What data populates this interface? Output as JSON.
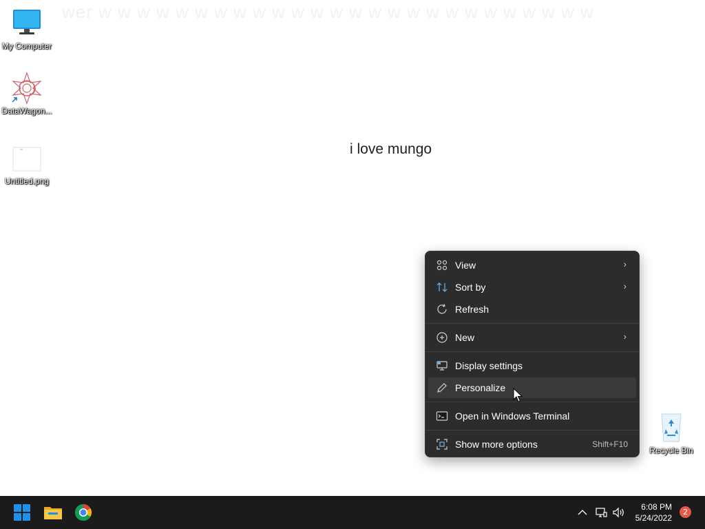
{
  "desktop": {
    "ghost_text": "wer w w w w w w w w w w w w w w w w w w w w w w w w w w",
    "center_text": "i love mungo",
    "icons": [
      {
        "label": "My Computer",
        "icon": "monitor-icon"
      },
      {
        "label": "DataWagon...",
        "icon": "datawagon-icon"
      },
      {
        "label": "Untitled.png",
        "icon": "image-file-icon"
      },
      {
        "label": "Recycle Bin",
        "icon": "recycle-bin-icon"
      }
    ]
  },
  "context_menu": {
    "items": [
      {
        "label": "View",
        "icon": "grid-icon",
        "submenu": true
      },
      {
        "label": "Sort by",
        "icon": "sort-icon",
        "submenu": true
      },
      {
        "label": "Refresh",
        "icon": "refresh-icon",
        "submenu": false
      },
      {
        "label": "New",
        "icon": "plus-circle-icon",
        "submenu": true
      },
      {
        "label": "Display settings",
        "icon": "display-icon",
        "submenu": false
      },
      {
        "label": "Personalize",
        "icon": "pen-icon",
        "submenu": false,
        "highlighted": true
      },
      {
        "label": "Open in Windows Terminal",
        "icon": "terminal-icon",
        "submenu": false
      },
      {
        "label": "Show more options",
        "icon": "expand-icon",
        "shortcut": "Shift+F10"
      }
    ],
    "submenu_arrow": "›"
  },
  "taskbar": {
    "apps": [
      {
        "name": "start",
        "icon": "windows-logo-icon"
      },
      {
        "name": "file-explorer",
        "icon": "folder-icon"
      },
      {
        "name": "chrome",
        "icon": "chrome-icon"
      }
    ],
    "tray": {
      "chevron": "^",
      "time": "6:08 PM",
      "date": "5/24/2022",
      "notifications": "2"
    }
  },
  "colors": {
    "menu_bg": "#2c2c2c",
    "menu_hover": "#3a3a3a",
    "taskbar_bg": "#1b1b1b",
    "windows_blue": "#1e90e8",
    "badge_red": "#e55b4b"
  }
}
